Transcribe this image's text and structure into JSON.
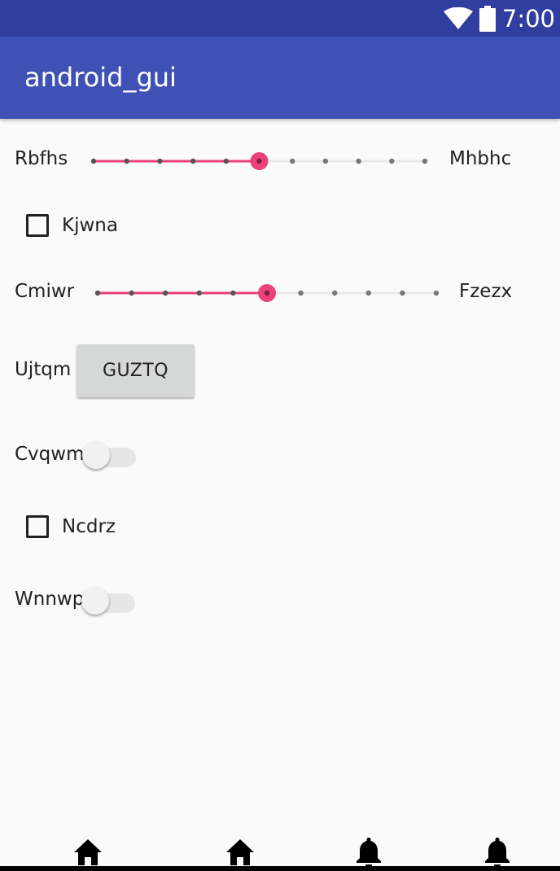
{
  "status_bar": {
    "time": "7:00"
  },
  "app_bar": {
    "title": "android_gui"
  },
  "seekbar_1": {
    "left_label": "Rbfhs",
    "right_label": "Mhbhc",
    "value": 5,
    "max": 10
  },
  "checkbox_1": {
    "label": "Kjwna",
    "checked": false
  },
  "seekbar_2": {
    "left_label": "Cmiwr",
    "right_label": "Fzezx",
    "value": 5,
    "max": 10
  },
  "button_row": {
    "label": "Ujtqm",
    "button_text": "GUZTQ"
  },
  "switch_1": {
    "label": "Cvqwm",
    "on": false
  },
  "checkbox_2": {
    "label": "Ncdrz",
    "checked": false
  },
  "switch_2": {
    "label": "Wnnwp",
    "on": false
  },
  "bottom_nav": {
    "items": [
      {
        "icon": "home-icon"
      },
      {
        "icon": "home-icon"
      },
      {
        "icon": "bell-icon"
      },
      {
        "icon": "bell-icon"
      }
    ]
  },
  "colors": {
    "status_bar": "#303f9f",
    "app_bar": "#3f51b5",
    "accent": "#ec407a",
    "background": "#fafafa"
  }
}
